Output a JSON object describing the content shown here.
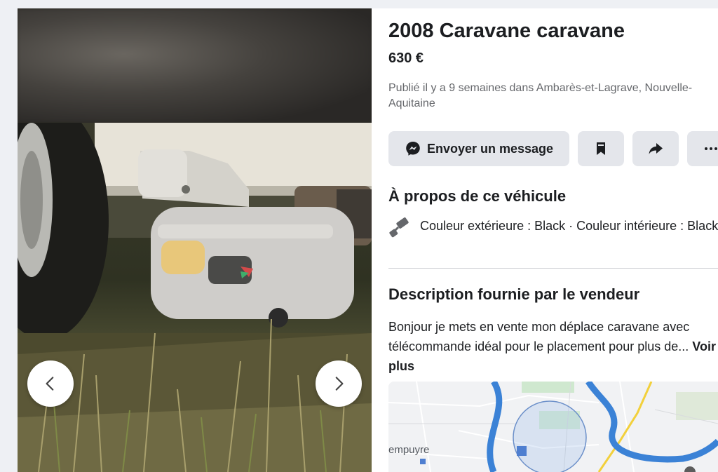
{
  "listing": {
    "title": "2008 Caravane caravane",
    "price": "630 €",
    "posted": "Publié il y a 9 semaines dans Ambarès-et-Lagrave, Nouvelle-Aquitaine"
  },
  "actions": {
    "message_label": "Envoyer un message",
    "save_icon": "bookmark-icon",
    "share_icon": "share-arrow-icon",
    "more_icon": "more-dots-icon"
  },
  "about": {
    "heading": "À propos de ce véhicule",
    "color_icon": "paint-roller-icon",
    "color_text": "Couleur extérieure : Black · Couleur intérieure : Black"
  },
  "description": {
    "heading": "Description fournie par le vendeur",
    "text": "Bonjour je mets en vente mon déplace caravane avec télécommande idéal pour le placement pour plus de...",
    "more_label": "Voir plus"
  },
  "map": {
    "place_label": "empuyre"
  },
  "viewer": {
    "prev_icon": "chevron-left-icon",
    "next_icon": "chevron-right-icon"
  },
  "colors": {
    "accent_button_bg": "#e4e6eb",
    "text_secondary": "#65676b",
    "map_river": "#3b82d6",
    "map_road": "#f2d03b"
  }
}
